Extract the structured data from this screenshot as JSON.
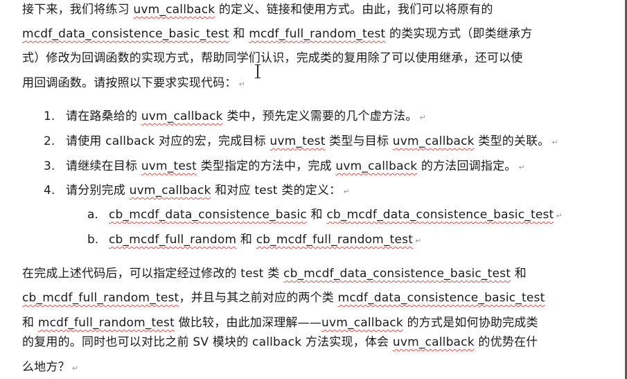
{
  "intro": {
    "l1": [
      {
        "t": "接下来，我们将练习 "
      },
      {
        "t": "uvm_callback",
        "c": true
      },
      {
        "t": " 的定义、链接和使用方式。由此，我们可以将原有的"
      }
    ],
    "l2": [
      {
        "t": "mcdf_data_consistence_basic_test",
        "c": true
      },
      {
        "t": " 和 "
      },
      {
        "t": "mcdf_full_random_test",
        "c": true
      },
      {
        "t": " 的类实现方式（即类继承方"
      }
    ],
    "l3": [
      {
        "t": "式）修改为回调函数的实现方式，帮助同学们认识，完成类的复用除了可以使用继承，还可以使"
      }
    ],
    "l4": [
      {
        "t": "用回调函数。请按照以下要求实现代码："
      }
    ]
  },
  "steps": [
    {
      "num": "1.",
      "parts": [
        {
          "t": "请在路桑给的 "
        },
        {
          "t": "uvm_callback",
          "c": true
        },
        {
          "t": " 类中，预先定义需要的几个虚方法。"
        }
      ]
    },
    {
      "num": "2.",
      "parts": [
        {
          "t": "请使用 callback 对应的宏，完成目标 "
        },
        {
          "t": "uvm_test",
          "c": true
        },
        {
          "t": " 类型与目标 "
        },
        {
          "t": "uvm_callback",
          "c": true
        },
        {
          "t": " 类型的关联。"
        }
      ]
    },
    {
      "num": "3.",
      "parts": [
        {
          "t": "请继续在目标 "
        },
        {
          "t": "uvm_test",
          "c": true
        },
        {
          "t": " 类型指定的方法中，完成 "
        },
        {
          "t": "uvm_callback",
          "c": true
        },
        {
          "t": " 的方法回调指定。"
        }
      ]
    },
    {
      "num": "4.",
      "parts": [
        {
          "t": "请分别完成 "
        },
        {
          "t": "uvm_callback",
          "c": true
        },
        {
          "t": " 和对应 test 类的定义："
        }
      ]
    }
  ],
  "substeps": [
    {
      "num": "a.",
      "parts": [
        {
          "t": "cb_mcdf_data_consistence_basic",
          "c": true
        },
        {
          "t": " 和 "
        },
        {
          "t": "cb_mcdf_data_consistence_basic_test",
          "c": true
        }
      ]
    },
    {
      "num": "b.",
      "parts": [
        {
          "t": "cb_mcdf_full_random",
          "c": true
        },
        {
          "t": " 和 "
        },
        {
          "t": "cb_mcdf_full_random_test",
          "c": true
        }
      ]
    }
  ],
  "outro": {
    "l1": [
      {
        "t": "在完成上述代码后，可以指定经过修改的 test 类 "
      },
      {
        "t": "cb_mcdf_data_consistence_basic_test",
        "c": true
      },
      {
        "t": " 和"
      }
    ],
    "l2": [
      {
        "t": "cb_mcdf_full_random_test",
        "c": true
      },
      {
        "t": "，并且与其之前对应的两个类 "
      },
      {
        "t": "mcdf_data_consistence_basic_test",
        "c": true
      }
    ],
    "l3": [
      {
        "t": "和 "
      },
      {
        "t": "mcdf_full_random_test",
        "c": true
      },
      {
        "t": " 做比较，由此加深理解——"
      },
      {
        "t": "uvm_callback",
        "c": true
      },
      {
        "t": " 的方式是如何协助完成类"
      }
    ],
    "l4": [
      {
        "t": "的复用的。同时也可以对比之前 SV 模块的 callback 方法实现，体会 "
      },
      {
        "t": "uvm_callback",
        "c": true
      },
      {
        "t": " 的优势在什"
      }
    ],
    "l5": [
      {
        "t": "么地方？"
      }
    ]
  },
  "para_mark": "↵"
}
